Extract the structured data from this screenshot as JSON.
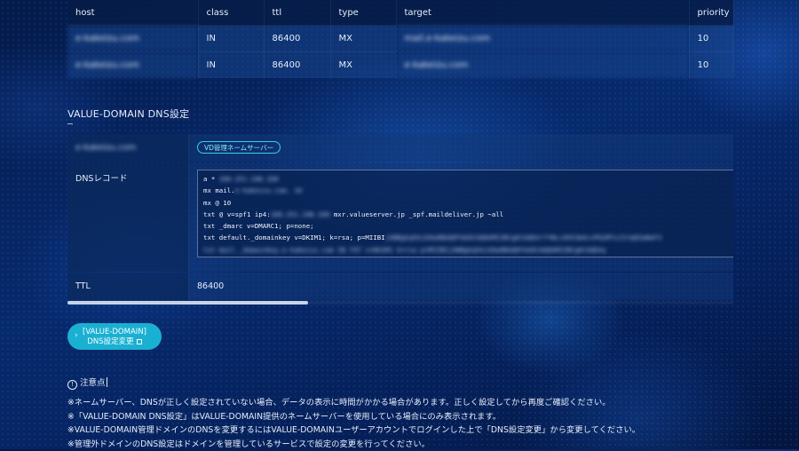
{
  "mx_table": {
    "headers": [
      "host",
      "class",
      "ttl",
      "type",
      "target",
      "priority"
    ],
    "rows": [
      [
        "e-kakeizu.com",
        "IN",
        "86400",
        "MX",
        "mail.e-kakeizu.com",
        "10"
      ],
      [
        "e-kakeizu.com",
        "IN",
        "86400",
        "MX",
        "e-kakeizu.com",
        "10"
      ]
    ]
  },
  "dns_section": {
    "title": "VALUE-DOMAIN DNS設定",
    "domain_label": "e-kakeizu.com",
    "nameserver_badge": "VD管理ネームサーバー",
    "records_label": "DNSレコード",
    "records": [
      {
        "text": "a *",
        "masked": "160.251.198.160"
      },
      {
        "text": "mx mail.",
        "masked": "e-kakeizu.com. 10"
      },
      {
        "text": "mx @ 10",
        "masked": ""
      },
      {
        "text": "txt @ v=spf1 ip4:",
        "masked": "160.251.198.160",
        "after": " mxr.valueserver.jp _spf.maildeliver.jp ~all"
      },
      {
        "text": "txt _dmarc v=DMARC1; p=none;",
        "masked": ""
      },
      {
        "text": "txt default._domainkey v=DKIM1; k=rsa; p=MIIBI",
        "masked": "jANBgkqhkiG9w0BAQEFAAOCAQ8AMIIBCgKCAQEAr7YNLcd9I3m4cvPb2RTxJ1Yq8ZwWaF3"
      },
      {
        "text": "",
        "masked": "txt mail._domainkey.e-kakeizu.com IN TXT v=DKIM1 k=rsa p=MIIBIjANBgkqhkiG9w0BAQEFAAOCAQ8AMIIBCgKCAQEAy"
      }
    ],
    "ttl_label": "TTL",
    "ttl_value": "86400"
  },
  "button": {
    "line1": "[VALUE-DOMAIN]",
    "line2": "DNS設定変更"
  },
  "notes": {
    "heading": "注意点",
    "items": [
      "※ネームサーバー、DNSが正しく設定されていない場合、データの表示に時間がかかる場合があります。正しく設定してから再度ご確認ください。",
      "※「VALUE-DOMAIN DNS設定」はVALUE-DOMAIN提供のネームサーバーを使用している場合にのみ表示されます。",
      "※VALUE-DOMAIN管理ドメインのDNSを変更するにはVALUE-DOMAINユーザーアカウントでログインした上で「DNS設定変更」から変更してください。",
      "※管理外ドメインのDNS設定はドメインを管理しているサービスで設定の変更を行ってください。"
    ]
  },
  "colors": {
    "accent": "#1ab0d2",
    "badge_border": "#38d0e6",
    "background": "#072a6e"
  }
}
